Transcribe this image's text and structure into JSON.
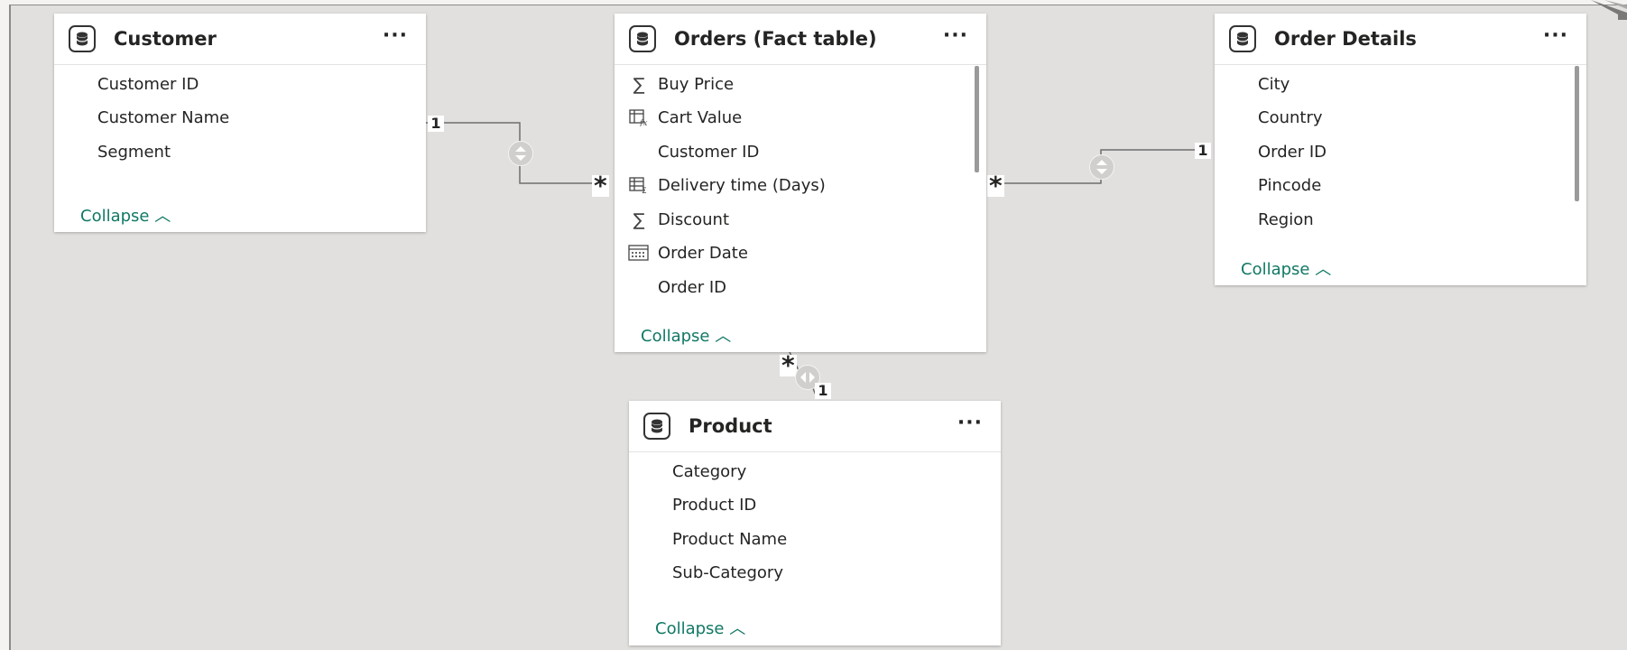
{
  "tables": {
    "customer": {
      "title": "Customer",
      "more": "···",
      "fields": [
        "Customer ID",
        "Customer Name",
        "Segment"
      ],
      "collapse": "Collapse"
    },
    "orders": {
      "title": "Orders (Fact table)",
      "more": "···",
      "fields": [
        {
          "name": "Buy Price",
          "icon": "sigma-icon"
        },
        {
          "name": "Cart Value",
          "icon": "calculated-column-icon"
        },
        {
          "name": "Customer ID",
          "icon": ""
        },
        {
          "name": "Delivery time (Days)",
          "icon": "calculated-table-icon"
        },
        {
          "name": "Discount",
          "icon": "sigma-icon"
        },
        {
          "name": "Order Date",
          "icon": "calendar-icon"
        },
        {
          "name": "Order ID",
          "icon": ""
        }
      ],
      "collapse": "Collapse"
    },
    "order_details": {
      "title": "Order Details",
      "more": "···",
      "fields": [
        "City",
        "Country",
        "Order ID",
        "Pincode",
        "Region"
      ],
      "collapse": "Collapse"
    },
    "product": {
      "title": "Product",
      "more": "···",
      "fields": [
        "Category",
        "Product ID",
        "Product Name",
        "Sub-Category"
      ],
      "collapse": "Collapse"
    }
  },
  "relationships": {
    "customer_orders": {
      "one": "1",
      "many": "*"
    },
    "orders_order_details": {
      "many": "*",
      "one": "1"
    },
    "orders_product": {
      "many": "*",
      "one": "1"
    }
  },
  "colors": {
    "canvas": "#e1e0de",
    "accent": "#117865",
    "text": "#252423"
  }
}
